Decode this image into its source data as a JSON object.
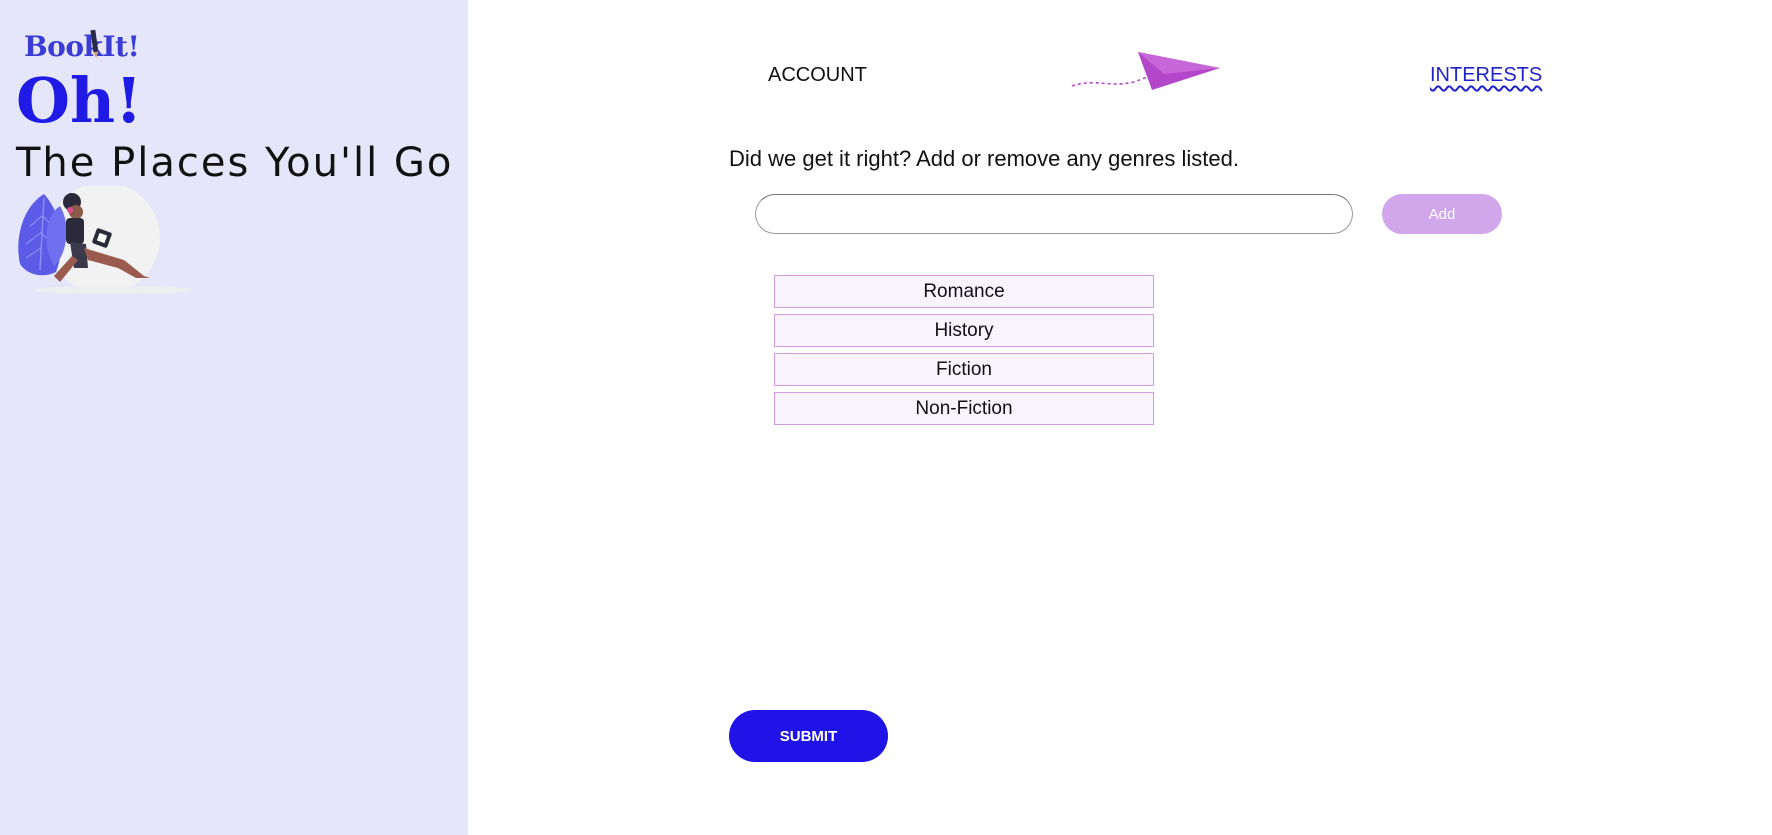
{
  "brand": {
    "logo_text": "BookIt!"
  },
  "hero": {
    "headline": "Oh!",
    "subhead": "The Places You'll Go"
  },
  "nav": {
    "account_label": "ACCOUNT",
    "interests_label": "INTERESTS"
  },
  "genres": {
    "prompt": "Did we get it right? Add or remove any genres listed.",
    "input_value": "",
    "input_placeholder": "",
    "add_label": "Add",
    "items": [
      "Romance",
      "History",
      "Fiction",
      "Non-Fiction"
    ]
  },
  "submit_label": "SUBMIT",
  "colors": {
    "sidebar_bg": "#e6e6fb",
    "accent": "#1f13e8",
    "add_button": "#d2a6eb",
    "genre_border": "#d49be5",
    "plane": "#b347c9"
  },
  "icons": {
    "plane": "paper-plane-icon",
    "pen": "pencil-icon"
  }
}
